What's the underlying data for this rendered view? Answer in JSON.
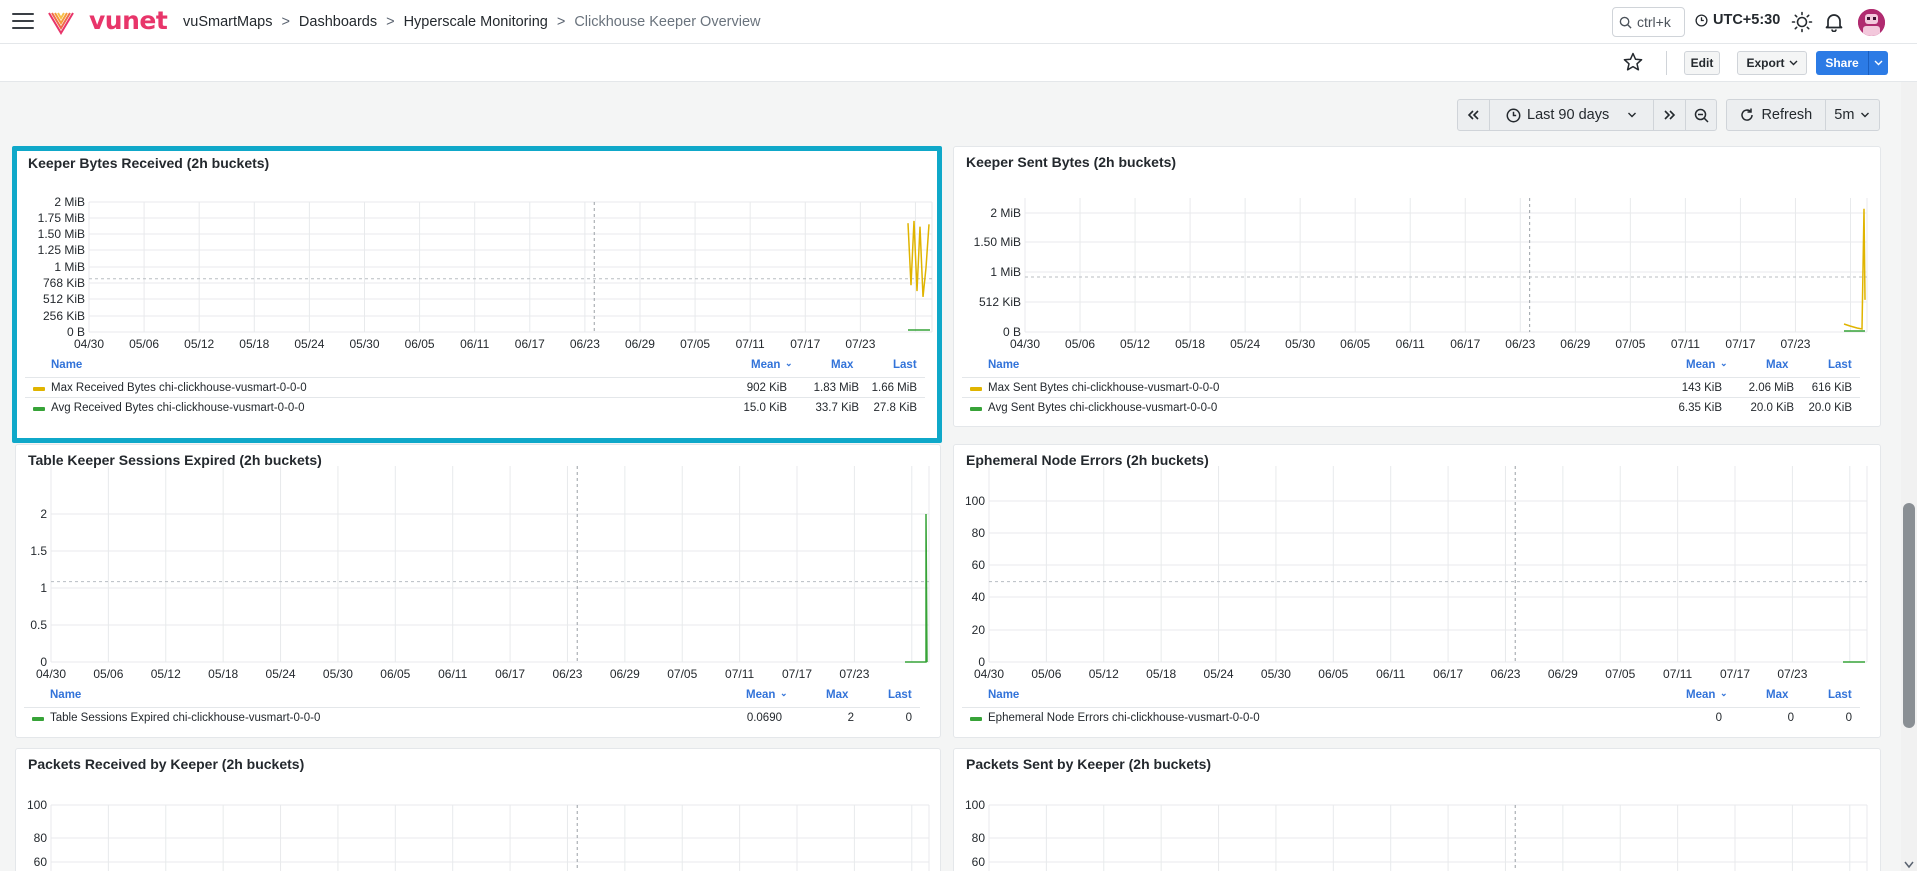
{
  "header": {
    "brand": "vunet",
    "breadcrumbs": [
      "vuSmartMaps",
      "Dashboards",
      "Hyperscale Monitoring"
    ],
    "current_page": "Clickhouse Keeper Overview",
    "search_shortcut": "ctrl+k",
    "timezone": "UTC+5:30"
  },
  "actions": {
    "edit": "Edit",
    "export": "Export",
    "share": "Share"
  },
  "timepicker": {
    "range": "Last 90 days",
    "refresh": "Refresh",
    "interval": "5m"
  },
  "colors": {
    "accent": "#2c7be5",
    "highlight": "#0fa8c9",
    "brand": "#e8356a",
    "series_yellow": "#e0b400",
    "series_green": "#37a338"
  },
  "x_tick_labels": [
    "04/30",
    "05/06",
    "05/12",
    "05/18",
    "05/24",
    "05/30",
    "06/05",
    "06/11",
    "06/17",
    "06/23",
    "06/29",
    "07/05",
    "07/11",
    "07/17",
    "07/23"
  ],
  "legend_columns": {
    "name": "Name",
    "mean": "Mean",
    "max": "Max",
    "last": "Last"
  },
  "panels": [
    {
      "title": "Keeper Bytes Received (2h buckets)",
      "selected": true,
      "y_ticks": [
        "0 B",
        "256 KiB",
        "512 KiB",
        "768 KiB",
        "1 MiB",
        "1.25 MiB",
        "1.50 MiB",
        "1.75 MiB",
        "2 MiB"
      ],
      "y_max_mib": 2,
      "series": [
        {
          "name": "Max Received Bytes chi-clickhouse-vusmart-0-0-0",
          "color": "#e0b400",
          "mean": "902 KiB",
          "max": "1.83 MiB",
          "last": "1.66 MiB"
        },
        {
          "name": "Avg Received Bytes chi-clickhouse-vusmart-0-0-0",
          "color": "#37a338",
          "mean": "15.0 KiB",
          "max": "33.7 KiB",
          "last": "27.8 KiB"
        }
      ]
    },
    {
      "title": "Keeper Sent Bytes (2h buckets)",
      "selected": false,
      "y_ticks": [
        "0 B",
        "512 KiB",
        "1 MiB",
        "1.50 MiB",
        "2 MiB"
      ],
      "y_max_mib": 2.2,
      "series": [
        {
          "name": "Max Sent Bytes chi-clickhouse-vusmart-0-0-0",
          "color": "#e0b400",
          "mean": "143 KiB",
          "max": "2.06 MiB",
          "last": "616 KiB"
        },
        {
          "name": "Avg Sent Bytes chi-clickhouse-vusmart-0-0-0",
          "color": "#37a338",
          "mean": "6.35 KiB",
          "max": "20.0 KiB",
          "last": "20.0 KiB"
        }
      ]
    },
    {
      "title": "Table Keeper Sessions Expired (2h buckets)",
      "selected": false,
      "y_ticks": [
        "0",
        "0.5",
        "1",
        "1.5",
        "2"
      ],
      "series": [
        {
          "name": "Table Sessions Expired chi-clickhouse-vusmart-0-0-0",
          "color": "#37a338",
          "mean": "0.0690",
          "max": "2",
          "last": "0"
        }
      ]
    },
    {
      "title": "Ephemeral Node Errors (2h buckets)",
      "selected": false,
      "y_ticks": [
        "0",
        "20",
        "40",
        "60",
        "80",
        "100"
      ],
      "series": [
        {
          "name": "Ephemeral Node Errors chi-clickhouse-vusmart-0-0-0",
          "color": "#37a338",
          "mean": "0",
          "max": "0",
          "last": "0"
        }
      ]
    },
    {
      "title": "Packets Received by Keeper (2h buckets)",
      "selected": false,
      "y_ticks": [
        "60",
        "80",
        "100"
      ]
    },
    {
      "title": "Packets Sent by Keeper (2h buckets)",
      "selected": false,
      "y_ticks": [
        "60",
        "80",
        "100"
      ]
    }
  ]
}
